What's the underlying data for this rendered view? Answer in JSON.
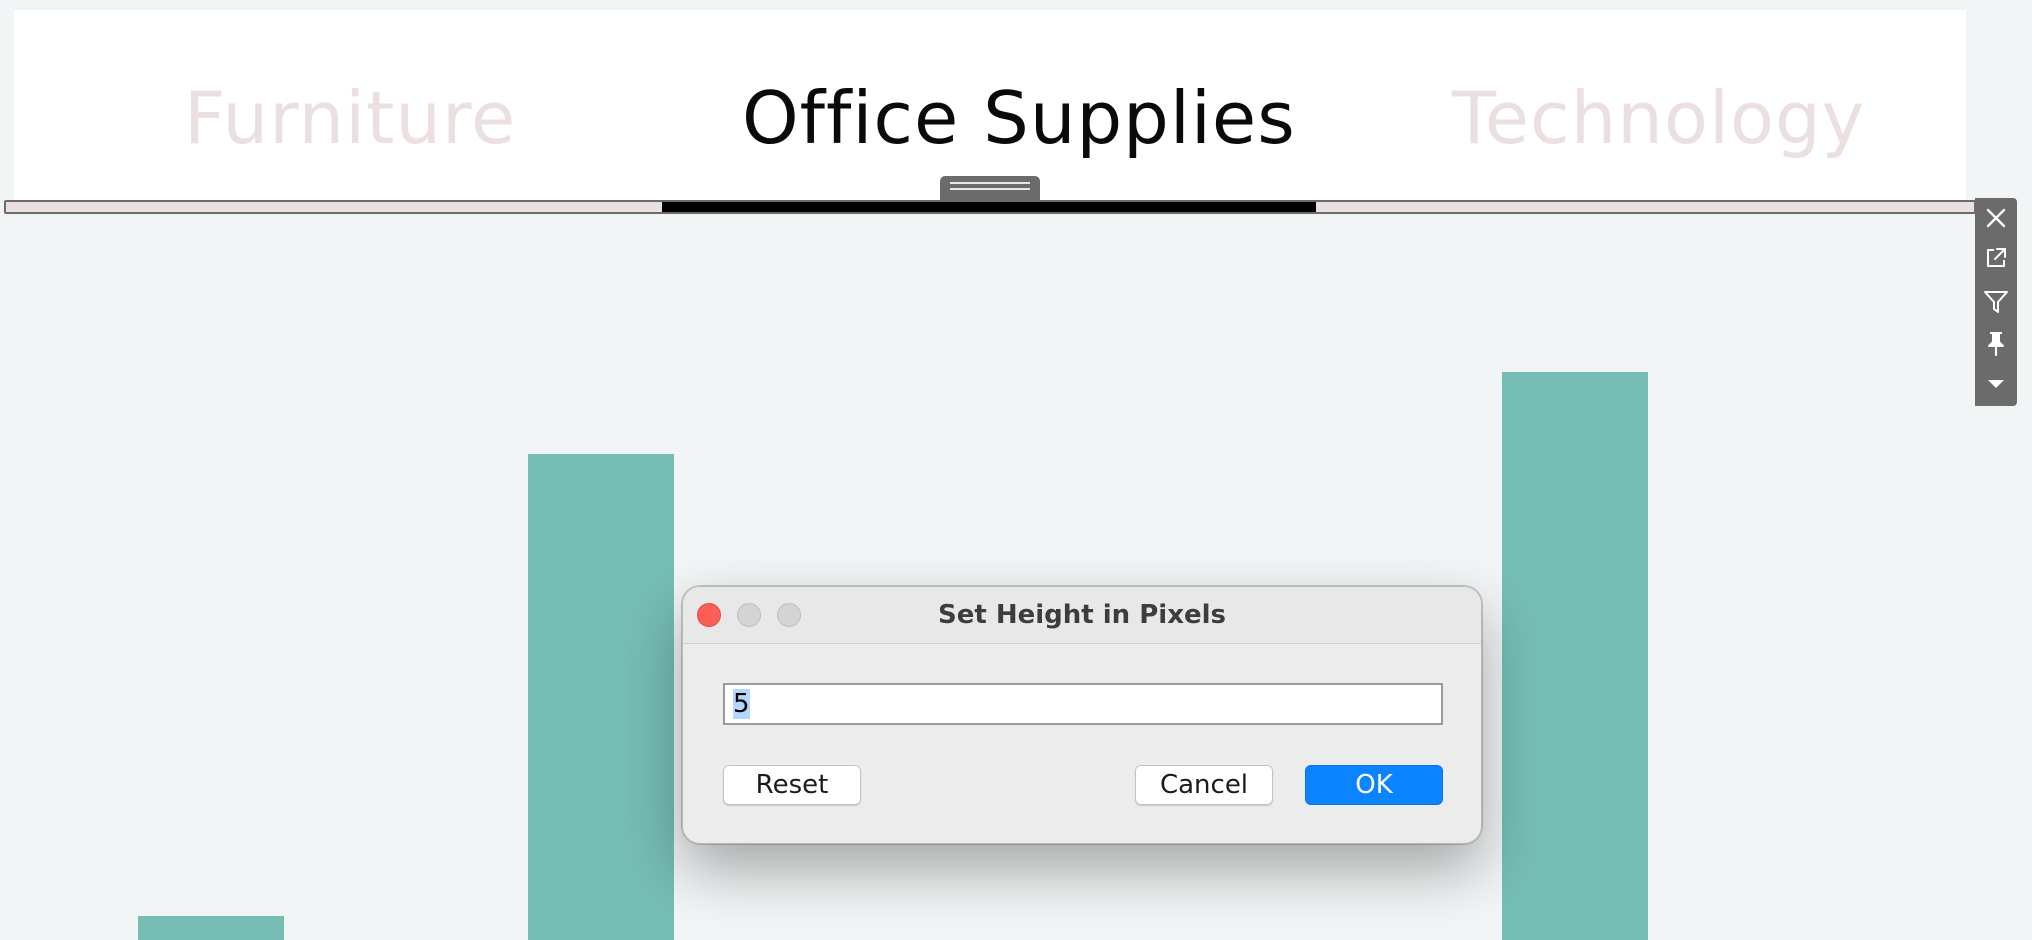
{
  "header": {
    "categories": [
      "Furniture",
      "Office Supplies",
      "Technology"
    ],
    "selected": "Office Supplies"
  },
  "toolbar": {
    "icons": [
      "close-icon",
      "external-link-icon",
      "filter-icon",
      "pin-icon",
      "caret-down-icon"
    ]
  },
  "dialog": {
    "title": "Set Height in Pixels",
    "input_value": "5",
    "buttons": {
      "reset": "Reset",
      "cancel": "Cancel",
      "ok": "OK"
    }
  },
  "colors": {
    "bar": "#76bdb4",
    "selected_text": "#0a0a0a",
    "unselected_text": "#ecdfdf",
    "ok_button": "#0a84ff",
    "close_light": "#fd5f57"
  }
}
